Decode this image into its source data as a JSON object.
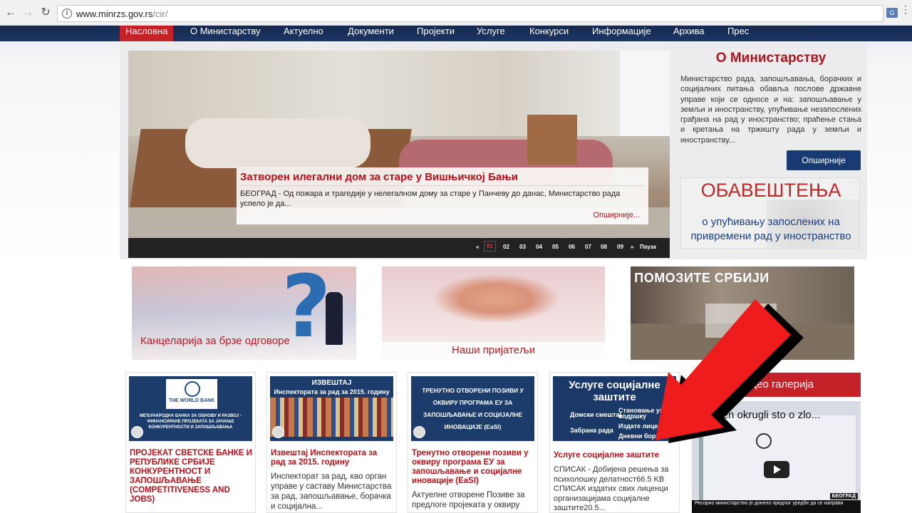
{
  "browser": {
    "url_host": "www.minrzs.gov.rs",
    "url_path": "/cir/"
  },
  "nav": {
    "items": [
      "Насловна",
      "О Министарству",
      "Актуелно",
      "Документи",
      "Пројекти",
      "Услуге",
      "Конкурси",
      "Информације",
      "Архива",
      "Прес"
    ]
  },
  "slider": {
    "title": "Затворен илегални дом за старе у Вишњичкој Бањи",
    "text": "БЕОГРАД - Од пожара и трагедије у нелегалном дому за старе у Панчеву до данас, Министарство рада успело је да...",
    "more": "Опширније...",
    "pager": [
      "«",
      "01",
      "02",
      "03",
      "04",
      "05",
      "06",
      "07",
      "08",
      "09",
      "»",
      "Пауза"
    ],
    "active_page": "01"
  },
  "about": {
    "title": "О Министарству",
    "text": "Министарство рада, запошљавања, борачких и социјалних питања обавља послове државне управе који се односе и на: запошљавање у земљи и иностранству, упућивање незапослених грађана на рад у иностранство; праћење стања и кретања на тржишту рада у земљи и иностранству...",
    "button": "Опширније"
  },
  "notice": {
    "heading": "ОБАВЕШТЕЊА",
    "text": "о упућивању запослених на привремени рад у иностранство"
  },
  "banners": {
    "b1": "Канцеларија за брзе одговоре",
    "b2": "Наши пријатељи",
    "b3": "ПОМОЗИТЕ СРБИЈИ"
  },
  "news": [
    {
      "img_logo": "THE WORLD BANK",
      "img_line": "МЕЂУНАРОДНА БАНКА ЗА ОБНОВУ И РАЗВОЈ - ФИНАНСИРАНЕ ПРОЈЕКАТА ЗА ЈАЧАЊЕ КОНКУРЕНТНОСТИ И ЗАПОШЉАВАЊА",
      "title": "ПРОЈЕКАТ СВЕТСКЕ БАНКЕ И РЕПУБЛИКЕ СРБИЈЕ КОНКУРЕНТНОСТ И ЗАПОШЉАВАЊЕ (COMPETITIVENESS AND JOBS)",
      "text": ""
    },
    {
      "img_heading": "ИЗВЕШТАЈ",
      "img_sub": "Инспектората за рад за 2015. годину",
      "title": "Извештај Инспектората за рад за 2015. годину",
      "text": "Инспекторат за рад, као орган управе у саставу Министарства за рад, запошљавање, борачка и социјална..."
    },
    {
      "img_heading": "ТРЕНУТНО ОТВОРЕНИ ПОЗИВИ У ОКВИРУ ПРОГРАМА ЕУ ЗА ЗАПОШЉАВАЊЕ И СОЦИЈАЛНЕ ИНОВАЦИЈЕ (EaSI)",
      "title": "Тренутно отворени позиви у оквиру програма ЕУ за запошљавање и социјалне иновације (EaSI)",
      "text": "Актуелне отворене Позиве за предлоге пројеката у оквиру"
    },
    {
      "img_heading": "Услуге социјалне заштите",
      "img_items": [
        "Домски смештај",
        "Становање уз подршку",
        "Забрана рада",
        "Издате лиценце",
        "Дневни боравак"
      ],
      "title": "Услуге социјалне заштите",
      "text": "СПИСАК - Добијена решења за психолошку делатност66.5 KB   СПИСАК издатих свих лиценци организацијама социјалне заштите20.5..."
    }
  ],
  "gallery": {
    "heading": "Видео галерија",
    "video_title": "Otvoren okrugli sto o zlo...",
    "bar_text": "Ресорно министарство је донело предлог уредбе да се направи",
    "tag": "БЕОГРАД"
  },
  "colors": {
    "nav_bg": "#1c3563",
    "accent_red": "#c42128",
    "title_red": "#b3121a",
    "button_blue": "#1a3a73"
  }
}
